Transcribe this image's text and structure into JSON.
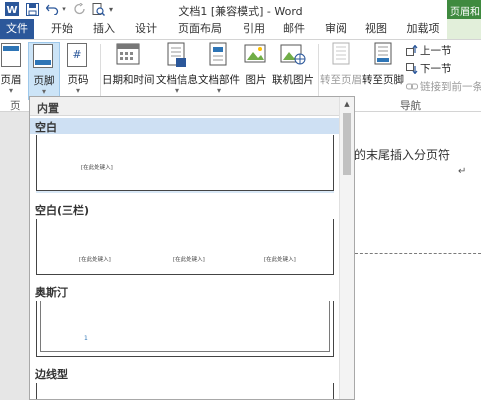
{
  "titlebar": {
    "title": "文档1 [兼容模式] - Word",
    "context_tab_group": "页眉和"
  },
  "qat": {
    "save_icon": "save-icon",
    "undo_icon": "undo-icon",
    "redo_icon": "redo-icon",
    "print_preview_icon": "print-preview-icon"
  },
  "tabs": {
    "file": "文件",
    "items": [
      "开始",
      "插入",
      "设计",
      "页面布局",
      "引用",
      "邮件",
      "审阅",
      "视图",
      "加载项"
    ]
  },
  "ribbon": {
    "header": "页眉",
    "footer": "页脚",
    "page_number": "页码",
    "date_time": "日期和时间",
    "doc_info": "文档信息",
    "doc_parts": "文档部件",
    "picture": "图片",
    "online_picture": "联机图片",
    "goto_header": "转至页眉",
    "goto_footer": "转至页脚",
    "prev": "上一节",
    "next": "下一节",
    "link_prev": "链接到前一条页眉",
    "group_hf": "页",
    "group_nav": "导航",
    "accent": "#2b579a",
    "context_green": "#3f8a3f"
  },
  "gallery": {
    "heading": "内置",
    "sections": [
      {
        "label": "空白",
        "placeholder": "[在此处键入]"
      },
      {
        "label": "空白(三栏)",
        "placeholders": [
          "[在此处键入]",
          "[在此处键入]",
          "[在此处键入]"
        ]
      },
      {
        "label": "奥斯汀",
        "placeholder": "1"
      },
      {
        "label": "边线型"
      }
    ]
  },
  "document": {
    "text": "的末尾插入分页符",
    "paragraph_mark": "↵",
    "line_mark": "↵"
  }
}
